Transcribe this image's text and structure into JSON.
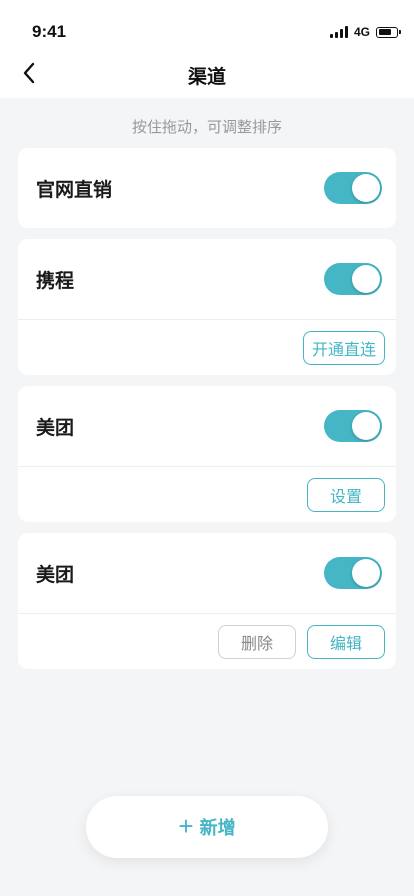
{
  "status_bar": {
    "time": "9:41",
    "network": "4G",
    "icons": [
      "signal-icon",
      "battery-icon"
    ]
  },
  "nav": {
    "title": "渠道",
    "back_icon": "chevron-left-icon"
  },
  "hint": "按住拖动，可调整排序",
  "channels": [
    {
      "name": "官网直销",
      "enabled": true,
      "actions": []
    },
    {
      "name": "携程",
      "enabled": true,
      "actions": [
        {
          "label": "开通直连",
          "style": "primary"
        }
      ]
    },
    {
      "name": "美团",
      "enabled": true,
      "actions": [
        {
          "label": "设置",
          "style": "primary"
        }
      ]
    },
    {
      "name": "美团",
      "enabled": true,
      "actions": [
        {
          "label": "删除",
          "style": "neutral"
        },
        {
          "label": "编辑",
          "style": "primary"
        }
      ]
    }
  ],
  "add_button": {
    "icon": "+",
    "label": "新增"
  },
  "colors": {
    "accent": "#45b6c5",
    "background": "#f4f5f7",
    "card": "#ffffff",
    "hint": "#999999",
    "neutral_border": "#d0d0d0"
  }
}
